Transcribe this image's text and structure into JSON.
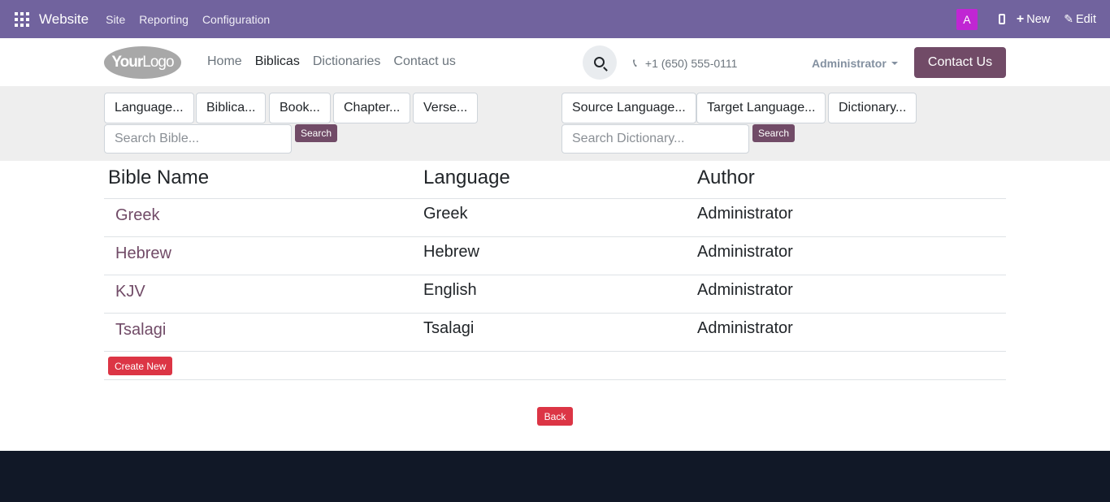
{
  "admin_bar": {
    "app_title": "Website",
    "menus": [
      "Site",
      "Reporting",
      "Configuration"
    ],
    "avatar_letter": "A",
    "new_label": "New",
    "edit_label": "Edit",
    "bar_color": "#71639e",
    "avatar_color": "#c026d3"
  },
  "header": {
    "logo": {
      "part1": "Your",
      "part2": "Logo"
    },
    "nav": [
      "Home",
      "Biblicas",
      "Dictionaries",
      "Contact us"
    ],
    "active_nav": "Biblicas",
    "phone": "+1 (650) 555-0111",
    "user_name": "Administrator",
    "contact_button": "Contact Us",
    "brand_color": "#714b67"
  },
  "bible_filters": {
    "buttons": [
      "Language...",
      "Biblica...",
      "Book...",
      "Chapter...",
      "Verse..."
    ],
    "search_placeholder": "Search Bible...",
    "search_button": "Search"
  },
  "dictionary_filters": {
    "buttons": [
      "Source Language...",
      "Target Language...",
      "Dictionary..."
    ],
    "search_placeholder": "Search Dictionary...",
    "search_button": "Search"
  },
  "table": {
    "columns": [
      "Bible Name",
      "Language",
      "Author"
    ],
    "rows": [
      {
        "name": "Greek",
        "language": "Greek",
        "author": "Administrator"
      },
      {
        "name": "Hebrew",
        "language": "Hebrew",
        "author": "Administrator"
      },
      {
        "name": "KJV",
        "language": "English",
        "author": "Administrator"
      },
      {
        "name": "Tsalagi",
        "language": "Tsalagi",
        "author": "Administrator"
      }
    ],
    "create_button": "Create New"
  },
  "back_button": "Back",
  "icons": {
    "apps": "apps-grid-icon",
    "mobile": "mobile-preview-icon",
    "new": "plus-icon",
    "edit": "pencil-icon",
    "search": "search-icon",
    "phone": "phone-icon",
    "caret": "caret-down-icon"
  }
}
